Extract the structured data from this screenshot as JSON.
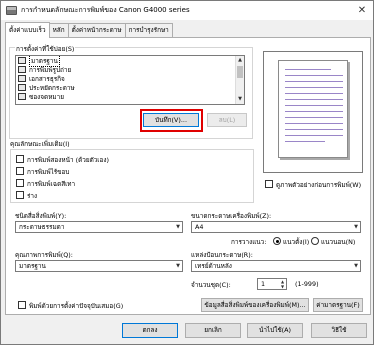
{
  "window": {
    "title": "การกำหนดลักษณะการพิมพ์ของ Canon G4000 series",
    "close_glyph": "✕"
  },
  "tabs": [
    "ตั้งค่าแบบเร็ว",
    "หลัก",
    "ตั้งค่าหน้ากระดาษ",
    "การบำรุงรักษา"
  ],
  "quick_setup": {
    "common_settings_label": "การตั้งค่าที่ใช้บ่อย(S)",
    "common_settings_items": [
      "มาตรฐาน",
      "การพิมพ์รูปถ่าย",
      "เอกสารธุรกิจ",
      "ประหยัดกระดาษ",
      "ซองจดหมาย"
    ],
    "save_button": "บันทึก(V)...",
    "delete_button": "ลบ(L)",
    "always_show_label": "ดูภาพตัวอย่างก่อนการพิมพ์(W)",
    "additional_features_label": "คุณลักษณะเพิ่มเติม(I)",
    "additional_features": [
      "การพิมพ์สองหน้า (ด้วยตัวเอง)",
      "การพิมพ์ไร้ขอบ",
      "การพิมพ์เฉดสีเทา",
      "ร่าง"
    ],
    "media_type_label": "ชนิดสื่อสิ่งพิมพ์(Y):",
    "media_type_value": "กระดาษธรรมดา",
    "paper_size_label": "ขนาดกระดาษเครื่องพิมพ์(Z):",
    "paper_size_value": "A4",
    "orientation_label": "การวางแนว:",
    "orientation_portrait": "แนวตั้ง(I)",
    "orientation_landscape": "แนวนอน(N)",
    "print_quality_label": "คุณภาพการพิมพ์(Q):",
    "print_quality_value": "มาตรฐาน",
    "paper_source_label": "แหล่งป้อนกระดาษ(R):",
    "paper_source_value": "เทรย์ด้านหลัง",
    "copies_label": "จำนวนชุด(C):",
    "copies_value": "1",
    "copies_range": "(1-999)",
    "always_print_current_label": "พิมพ์ด้วยการตั้งค่าปัจจุบันเสมอ(G)",
    "printer_media_info_button": "ข้อมูลสื่อสิ่งพิมพ์ของเครื่องพิมพ์(M)...",
    "defaults_button": "ค่ามาตรฐาน(F)"
  },
  "footer": {
    "ok": "ตกลง",
    "cancel": "ยกเลิก",
    "apply": "นำไปใช้(A)",
    "help": "วิธีใช้"
  }
}
